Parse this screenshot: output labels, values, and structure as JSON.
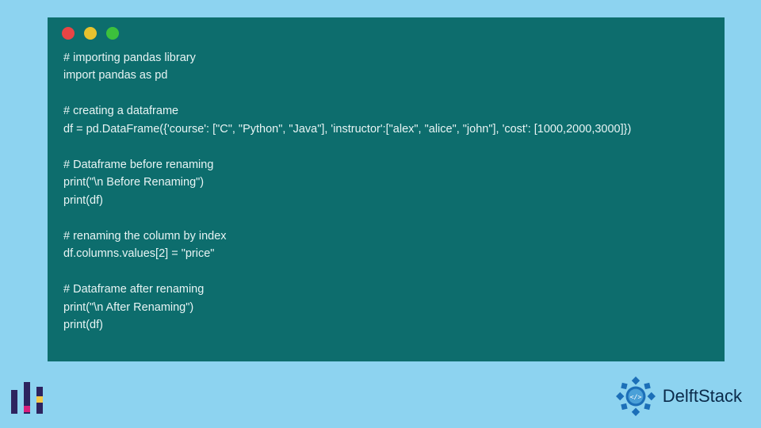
{
  "window": {
    "dots": {
      "red": "#e84545",
      "yellow": "#e8c22e",
      "green": "#3cc13c"
    }
  },
  "code": {
    "lines": [
      "# importing pandas library",
      "import pandas as pd",
      "",
      "# creating a dataframe",
      "df = pd.DataFrame({'course': [\"C\", \"Python\", \"Java\"], 'instructor':[\"alex\", \"alice\", \"john\"], 'cost': [1000,2000,3000]})",
      "",
      "# Dataframe before renaming",
      "print(\"\\n Before Renaming\")",
      "print(df)",
      "",
      "# renaming the column by index",
      "df.columns.values[2] = \"price\"",
      "",
      "# Dataframe after renaming",
      "print(\"\\n After Renaming\")",
      "print(df)"
    ]
  },
  "brand": {
    "delft": "Delft",
    "stack": "Stack"
  },
  "colors": {
    "page_bg": "#8dd3f0",
    "code_bg": "#0d6d6d",
    "code_fg": "#e8f4f4",
    "badge": "#1c6fb8"
  }
}
